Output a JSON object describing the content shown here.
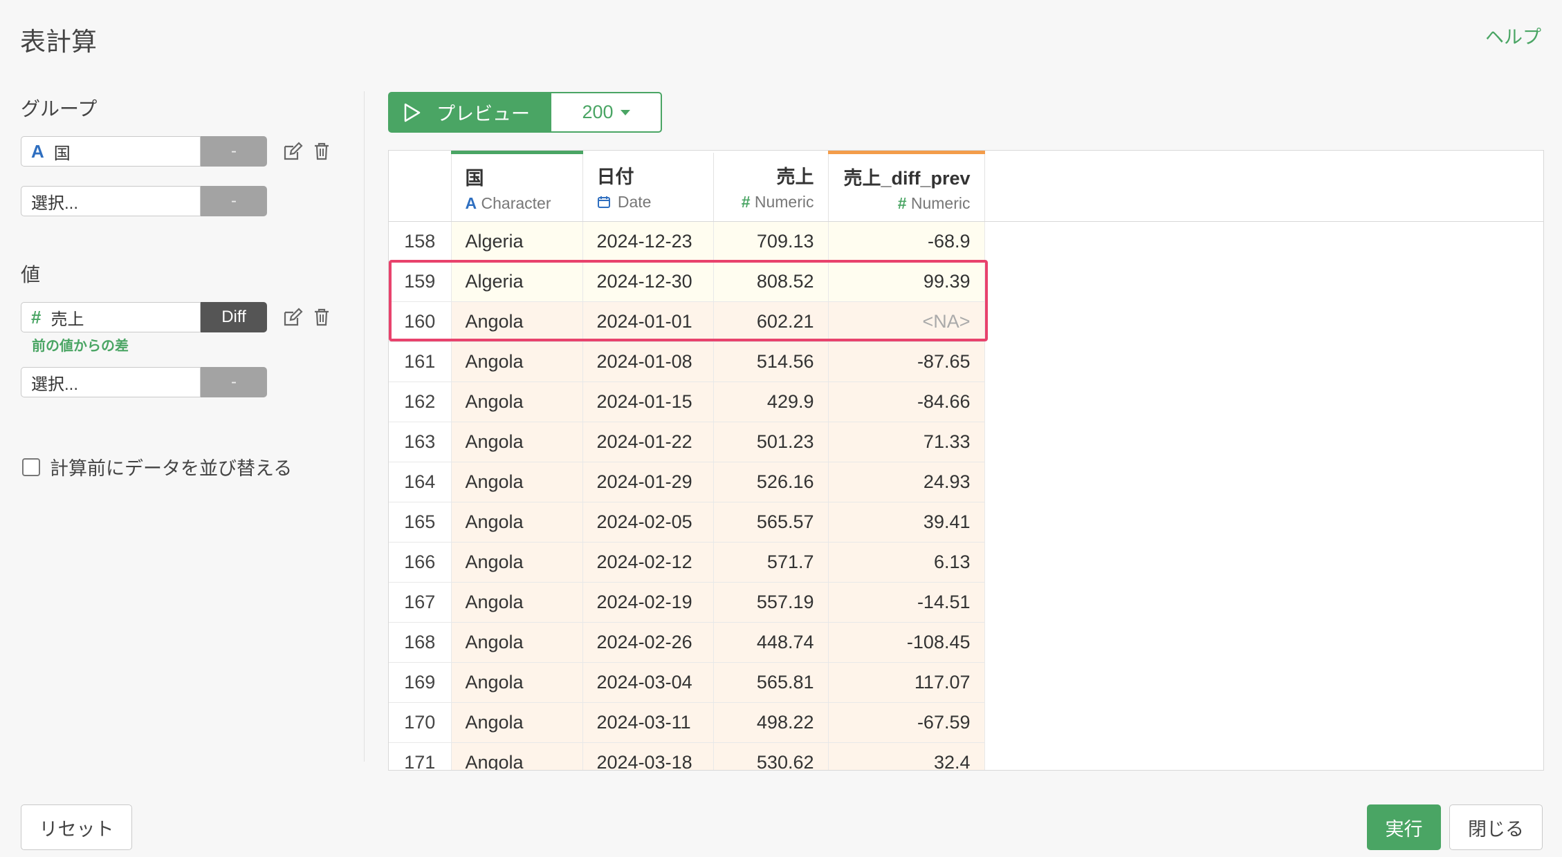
{
  "dialog": {
    "title": "表計算",
    "help_label": "ヘルプ"
  },
  "group": {
    "label": "グループ",
    "field1": {
      "type_icon": "character-type-icon",
      "type_glyph": "A",
      "value": "国",
      "button": "-"
    },
    "field2": {
      "placeholder": "選択...",
      "button": "-"
    }
  },
  "value": {
    "label": "値",
    "field1": {
      "type_icon": "numeric-type-icon",
      "type_glyph": "#",
      "value": "売上",
      "button": "Diff"
    },
    "hint": "前の値からの差",
    "field2": {
      "placeholder": "選択...",
      "button": "-"
    }
  },
  "sort_checkbox": {
    "label": "計算前にデータを並び替える",
    "checked": false
  },
  "preview": {
    "label": "プレビュー",
    "count": "200"
  },
  "table": {
    "columns": [
      {
        "name": "国",
        "type": "Character",
        "type_glyph": "A",
        "type_icon": "character-type-icon"
      },
      {
        "name": "日付",
        "type": "Date",
        "type_glyph": "📅",
        "type_icon": "calendar-icon"
      },
      {
        "name": "売上",
        "type": "Numeric",
        "type_glyph": "#",
        "type_icon": "numeric-type-icon"
      },
      {
        "name": "売上_diff_prev",
        "type": "Numeric",
        "type_glyph": "#",
        "type_icon": "numeric-type-icon"
      }
    ],
    "rows": [
      {
        "n": "158",
        "country": "Algeria",
        "date": "2024-12-23",
        "sales": "709.13",
        "diff": "-68.9"
      },
      {
        "n": "159",
        "country": "Algeria",
        "date": "2024-12-30",
        "sales": "808.52",
        "diff": "99.39"
      },
      {
        "n": "160",
        "country": "Angola",
        "date": "2024-01-01",
        "sales": "602.21",
        "diff": "<NA>"
      },
      {
        "n": "161",
        "country": "Angola",
        "date": "2024-01-08",
        "sales": "514.56",
        "diff": "-87.65"
      },
      {
        "n": "162",
        "country": "Angola",
        "date": "2024-01-15",
        "sales": "429.9",
        "diff": "-84.66"
      },
      {
        "n": "163",
        "country": "Angola",
        "date": "2024-01-22",
        "sales": "501.23",
        "diff": "71.33"
      },
      {
        "n": "164",
        "country": "Angola",
        "date": "2024-01-29",
        "sales": "526.16",
        "diff": "24.93"
      },
      {
        "n": "165",
        "country": "Angola",
        "date": "2024-02-05",
        "sales": "565.57",
        "diff": "39.41"
      },
      {
        "n": "166",
        "country": "Angola",
        "date": "2024-02-12",
        "sales": "571.7",
        "diff": "6.13"
      },
      {
        "n": "167",
        "country": "Angola",
        "date": "2024-02-19",
        "sales": "557.19",
        "diff": "-14.51"
      },
      {
        "n": "168",
        "country": "Angola",
        "date": "2024-02-26",
        "sales": "448.74",
        "diff": "-108.45"
      },
      {
        "n": "169",
        "country": "Angola",
        "date": "2024-03-04",
        "sales": "565.81",
        "diff": "117.07"
      },
      {
        "n": "170",
        "country": "Angola",
        "date": "2024-03-11",
        "sales": "498.22",
        "diff": "-67.59"
      },
      {
        "n": "171",
        "country": "Angola",
        "date": "2024-03-18",
        "sales": "530.62",
        "diff": "32.4"
      }
    ]
  },
  "footer": {
    "reset_label": "リセット",
    "run_label": "実行",
    "close_label": "閉じる"
  },
  "colors": {
    "accent": "#4aa564",
    "highlight": "#e8426c",
    "diff_column_top": "#f39c4a"
  }
}
